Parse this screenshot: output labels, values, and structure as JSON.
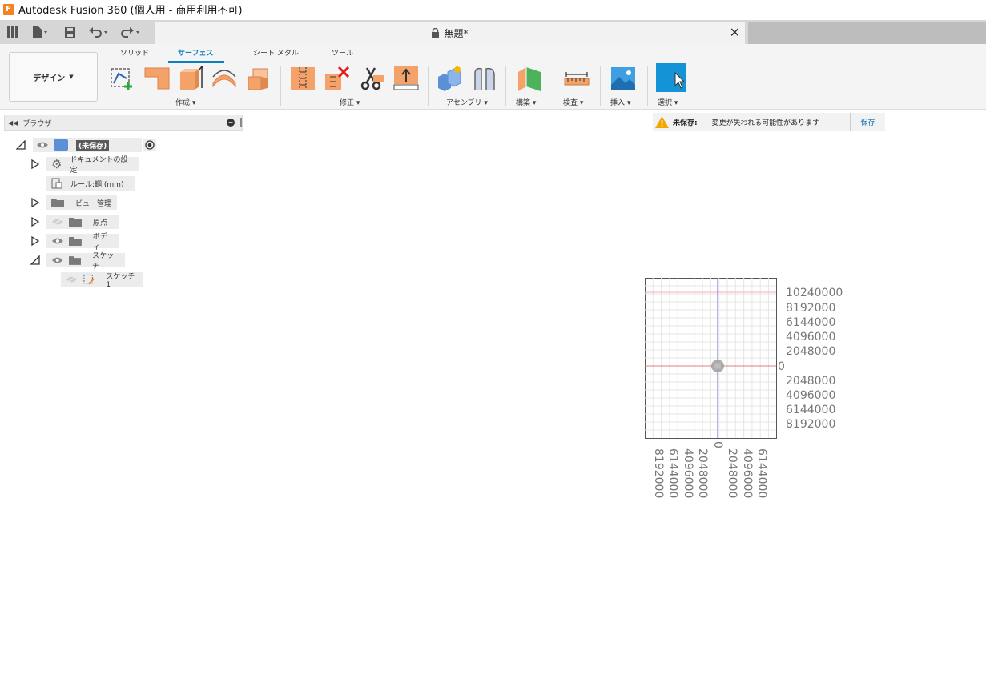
{
  "window": {
    "title": "Autodesk Fusion 360 (個人用 - 商用利用不可)",
    "app_icon": "F"
  },
  "document_tab": {
    "title": "無題*"
  },
  "workspace": {
    "label": "デザイン"
  },
  "ribbon_tabs": [
    {
      "label": "ソリッド"
    },
    {
      "label": "サーフェス",
      "active": true
    },
    {
      "label": "シート メタル"
    },
    {
      "label": "ツール"
    }
  ],
  "ribbon_groups": {
    "create": "作成",
    "modify": "修正",
    "assemble": "アセンブリ",
    "construct": "構築",
    "inspect": "検査",
    "insert": "挿入",
    "select": "選択"
  },
  "browser": {
    "title": "ブラウザ",
    "root": "(未保存)",
    "items": [
      {
        "label": "ドキュメントの設定"
      },
      {
        "label": "ルール:鋼 (mm)"
      },
      {
        "label": "ビュー管理"
      },
      {
        "label": "原点"
      },
      {
        "label": "ボディ"
      },
      {
        "label": "スケッチ"
      },
      {
        "label": "スケッチ1"
      }
    ]
  },
  "warning": {
    "title": "未保存:",
    "message": "変更が失われる可能性があります",
    "save_label": "保存"
  },
  "grid_labels": {
    "y_values": [
      "10240000",
      "8192000",
      "6144000",
      "4096000",
      "2048000",
      "0",
      "2048000",
      "4096000",
      "6144000",
      "8192000"
    ],
    "x_values": [
      "8192000",
      "6144000",
      "4096000",
      "2048000",
      "0",
      "2048000",
      "4096000",
      "6144000"
    ]
  },
  "colors": {
    "accent": "#0a7fc2",
    "surface_orange": "#f4a26a",
    "warning": "#f0a500"
  }
}
